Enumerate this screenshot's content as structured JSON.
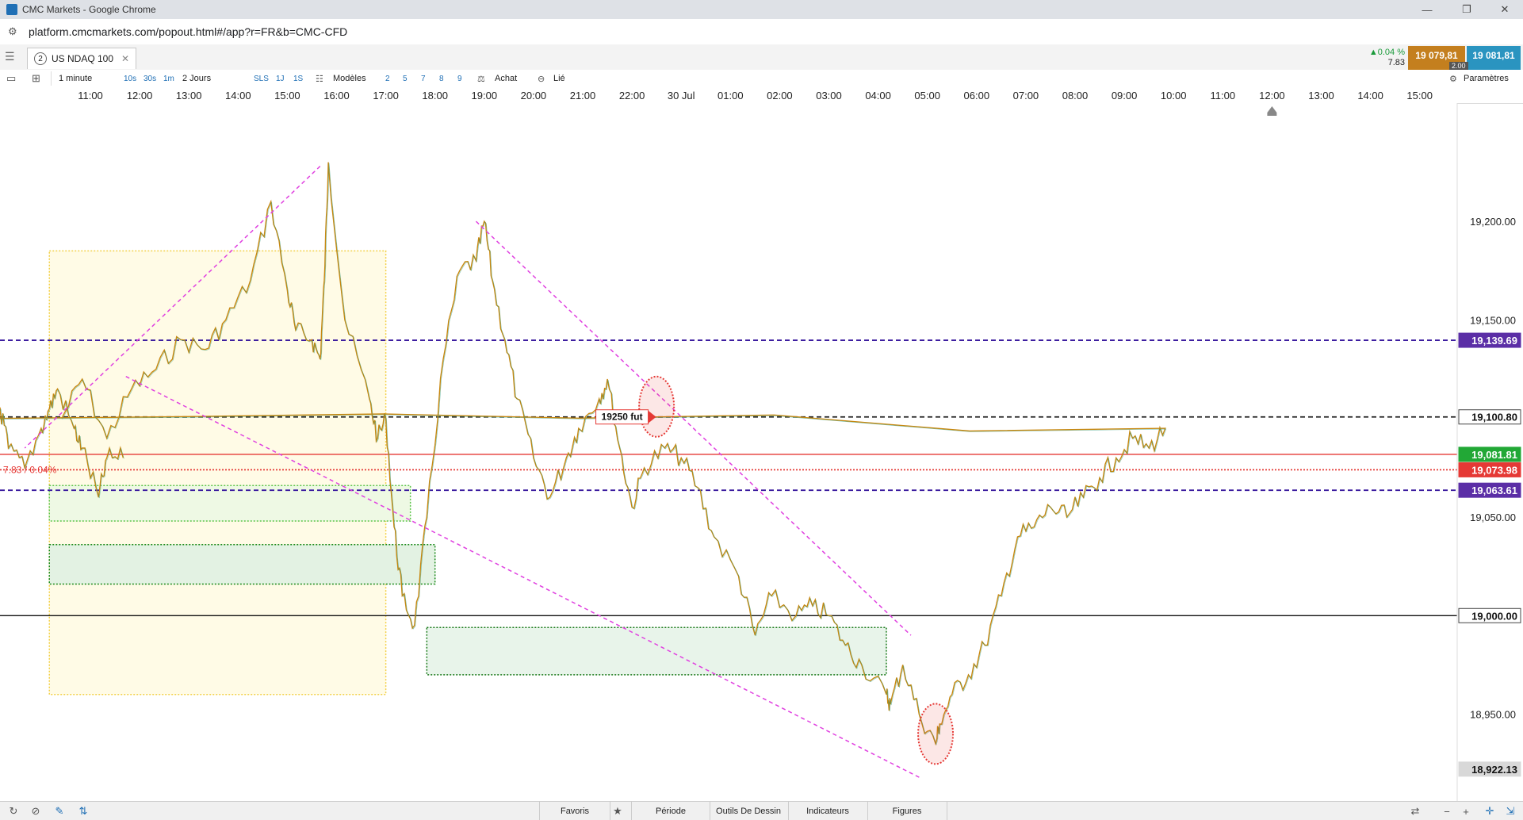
{
  "window": {
    "title": "CMC Markets - Google Chrome"
  },
  "browser": {
    "url": "platform.cmcmarkets.com/popout.html#/app?r=FR&b=CMC-CFD"
  },
  "instrument": {
    "tab_number": "2",
    "name": "US NDAQ 100"
  },
  "quote": {
    "change_pct": "▲0.04 %",
    "change_abs": "7.83",
    "bid": "19 079,81",
    "ask": "19 081,81",
    "spread": "2.00"
  },
  "toolbar": {
    "interval": "1 minute",
    "intervals": [
      "10s",
      "30s",
      "1m"
    ],
    "period": "2 Jours",
    "periods": [
      "SLS",
      "1J",
      "1S"
    ],
    "templates": "Modèles",
    "counts": [
      "2",
      "5",
      "7",
      "8",
      "9"
    ],
    "buy": "Achat",
    "link": "Lié",
    "settings": "Paramètres"
  },
  "time_axis": [
    "11:00",
    "12:00",
    "13:00",
    "14:00",
    "15:00",
    "16:00",
    "17:00",
    "18:00",
    "19:00",
    "20:00",
    "21:00",
    "22:00",
    "30 Jul",
    "01:00",
    "02:00",
    "03:00",
    "04:00",
    "05:00",
    "06:00",
    "07:00",
    "08:00",
    "09:00",
    "10:00",
    "11:00",
    "12:00",
    "13:00",
    "14:00",
    "15:00"
  ],
  "chart_data": {
    "type": "line",
    "instrument": "US NDAQ 100",
    "interval": "1 minute",
    "ylim": [
      18910,
      19260
    ],
    "y_ticks": [
      "19,200.00",
      "19,150.00",
      "19,100.00",
      "19,050.00",
      "19,000.00",
      "18,950.00"
    ],
    "y_tick_values": [
      19200,
      19150,
      19100,
      19050,
      19000,
      18950
    ],
    "x_ticks": [
      "11:00",
      "12:00",
      "13:00",
      "14:00",
      "15:00",
      "16:00",
      "17:00",
      "18:00",
      "19:00",
      "20:00",
      "21:00",
      "22:00",
      "30 Jul",
      "01:00",
      "02:00",
      "03:00",
      "04:00",
      "05:00",
      "06:00",
      "07:00",
      "08:00",
      "09:00",
      "10:00",
      "11:00",
      "12:00",
      "13:00",
      "14:00",
      "15:00"
    ],
    "series": [
      {
        "color": "#c8870f",
        "x": [
          "10:25",
          "10:50",
          "11:20",
          "11:50",
          "12:20",
          "12:50",
          "13:20",
          "13:45",
          "14:15",
          "14:40",
          "15:00",
          "15:10",
          "15:30",
          "15:40",
          "15:45",
          "15:50",
          "16:10",
          "16:40",
          "16:50",
          "17:00",
          "17:10",
          "17:20",
          "17:35",
          "17:50",
          "18:10",
          "18:30",
          "18:50",
          "19:00",
          "19:10",
          "19:25",
          "19:40",
          "20:00",
          "20:20",
          "20:40",
          "20:55",
          "21:20",
          "21:30",
          "21:45",
          "22:00",
          "22:15",
          "22:40",
          "23:00",
          "23:20",
          "23:40",
          "00:10",
          "00:30",
          "00:50",
          "01:20",
          "01:40",
          "02:00",
          "02:20",
          "02:40",
          "03:10",
          "03:15",
          "03:30",
          "03:50",
          "04:10",
          "04:15",
          "04:30",
          "04:50",
          "05:10",
          "05:30",
          "05:50",
          "06:10",
          "06:30",
          "06:50",
          "07:10",
          "07:30",
          "07:50",
          "08:10",
          "08:30",
          "08:50",
          "09:00",
          "09:10",
          "09:20",
          "09:40",
          "10:00",
          "10:10",
          "10:20",
          "10:40",
          "10:50",
          "11:10",
          "11:20",
          "11:40"
        ],
        "y": [
          19100,
          19120,
          19090,
          19115,
          19125,
          19140,
          19135,
          19150,
          19170,
          19210,
          19165,
          19145,
          19140,
          19130,
          19170,
          19230,
          19150,
          19110,
          19090,
          19100,
          19045,
          19010,
          18995,
          19050,
          19130,
          19175,
          19180,
          19200,
          19170,
          19140,
          19110,
          19080,
          19060,
          19080,
          19095,
          19110,
          19120,
          19085,
          19055,
          19075,
          19085,
          19080,
          19065,
          19040,
          19020,
          18990,
          19010,
          19000,
          19005,
          19000,
          18985,
          18975,
          18960,
          18955,
          18975,
          18950,
          18935,
          18945,
          18960,
          18970,
          18985,
          19010,
          19040,
          19045,
          19055,
          19050,
          19060,
          19070,
          19080,
          19090,
          19085,
          19095,
          19100,
          19105,
          19085,
          19075,
          19095,
          19105,
          19115,
          19095,
          19085,
          19060,
          19080,
          19080
        ]
      }
    ],
    "horizontal_lines": [
      {
        "value": 19139.69,
        "label": "19,139.69",
        "style": "dashed",
        "color": "#3a1a9e"
      },
      {
        "value": 19100.8,
        "label": "19,100.80",
        "style": "dashed",
        "color": "#222222"
      },
      {
        "value": 19081.81,
        "label": "19,081.81",
        "style": "solid",
        "color": "#e53935"
      },
      {
        "value": 19073.98,
        "label": "19,073.98",
        "style": "dotted",
        "color": "#e53935"
      },
      {
        "value": 19063.61,
        "label": "19,063.61",
        "style": "dashed",
        "color": "#3a1a9e"
      },
      {
        "value": 19000.0,
        "label": "19,000.00",
        "style": "solid",
        "color": "#111111"
      }
    ],
    "current_low": {
      "value": 18922.13,
      "label": "18,922.13"
    },
    "change_label": "7.83 / 0.04%",
    "future_annotation": {
      "text": "19250 fut",
      "value": 19100.8,
      "x": "21:45"
    },
    "trendlines": [
      {
        "from": [
          "15:40",
          19228
        ],
        "to": [
          "09:40",
          19085
        ],
        "color": "#e040e0"
      },
      {
        "from": [
          "18:50",
          19200
        ],
        "to": [
          "03:40",
          18990
        ],
        "color": "#e040e0"
      },
      {
        "from": [
          "03:50",
          18918
        ],
        "to": [
          "11:40",
          19122
        ],
        "color": "#e040e0"
      }
    ],
    "zones": [
      {
        "x_from": "10:10",
        "x_to": "17:00",
        "y_from": 19185,
        "y_to": 18960,
        "fill": "#fffbe6",
        "border": "#f3d14a"
      },
      {
        "x_from": "10:10",
        "x_to": "17:30",
        "y_from": 19066,
        "y_to": 19048,
        "fill": "#eef9e4",
        "border": "#5cc44a"
      },
      {
        "x_from": "10:10",
        "x_to": "18:00",
        "y_from": 19036,
        "y_to": 19016,
        "fill": "#e3f2e3",
        "border": "#1a8a1a"
      },
      {
        "x_from": "17:50",
        "x_to": "03:10",
        "y_from": 18994,
        "y_to": 18970,
        "fill": "#e8f4ea",
        "border": "#1a7a1a"
      }
    ],
    "circles": [
      {
        "x": "22:30",
        "y": 19106,
        "color": "#e53935"
      },
      {
        "x": "04:10",
        "y": 18940,
        "color": "#e53935"
      }
    ]
  },
  "bottom": {
    "favorites": "Favoris",
    "period": "Période",
    "drawing": "Outils De Dessin",
    "indicators": "Indicateurs",
    "figures": "Figures"
  },
  "icons": [
    "refresh-icon",
    "no-icon",
    "pencil-icon",
    "arrows-icon",
    "star-icon",
    "menu-icon",
    "settings-icon",
    "zoom-in-icon",
    "zoom-out-icon",
    "crosshair-icon"
  ]
}
